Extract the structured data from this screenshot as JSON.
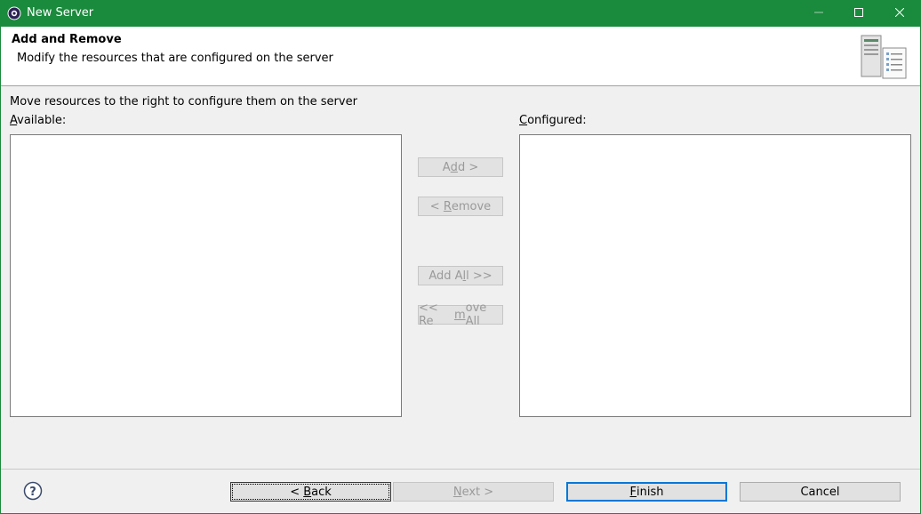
{
  "window": {
    "title": "New Server",
    "app_icon": "eclipse-gear-icon",
    "controls": {
      "minimize": "minimize-icon",
      "maximize": "maximize-icon",
      "close": "close-icon"
    },
    "accent_color": "#1a8a3c"
  },
  "header": {
    "title": "Add and Remove",
    "description": "Modify the resources that are configured on the server",
    "image": "server-wizard-banner-icon"
  },
  "body": {
    "instructions": "Move resources to the right to configure them on the server",
    "available": {
      "label_mnemonic": "A",
      "label_rest": "vailable:",
      "items": []
    },
    "configured": {
      "label_mnemonic": "C",
      "label_rest": "onfigured:",
      "items": []
    },
    "buttons": {
      "add": {
        "pre": "A",
        "mn": "d",
        "post": "d >"
      },
      "remove": {
        "pre": "< ",
        "mn": "R",
        "post": "emove"
      },
      "add_all": {
        "pre": "Add A",
        "mn": "l",
        "post": "l >>"
      },
      "remove_all": {
        "pre": "<< Re",
        "mn": "m",
        "post": "ove All"
      }
    }
  },
  "footer": {
    "help_icon": "help-icon",
    "back": {
      "pre": "< ",
      "mn": "B",
      "post": "ack"
    },
    "next": {
      "pre": "",
      "mn": "N",
      "post": "ext >"
    },
    "finish": {
      "pre": "",
      "mn": "F",
      "post": "inish"
    },
    "cancel": "Cancel"
  }
}
